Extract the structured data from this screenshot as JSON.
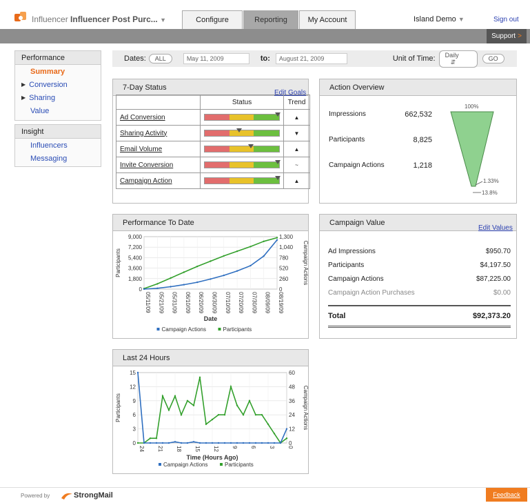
{
  "header": {
    "app_name": "Influencer",
    "campaign_title": "Influencer Post Purc...",
    "tabs": [
      {
        "label": "Configure"
      },
      {
        "label": "Reporting"
      },
      {
        "label": "My Account"
      }
    ],
    "account": "Island Demo",
    "signout": "Sign out",
    "support": "Support"
  },
  "sidebar": {
    "performance_title": "Performance",
    "performance_items": [
      {
        "label": "Summary",
        "active": true
      },
      {
        "label": "Conversion",
        "expandable": true
      },
      {
        "label": "Sharing",
        "expandable": true
      },
      {
        "label": "Value"
      }
    ],
    "insight_title": "Insight",
    "insight_items": [
      {
        "label": "Influencers"
      },
      {
        "label": "Messaging"
      }
    ]
  },
  "datebar": {
    "dates_label": "Dates:",
    "all_button": "ALL",
    "from_date": "May 11, 2009",
    "to_label": "to:",
    "to_date": "August 21, 2009",
    "unit_label": "Unit of Time:",
    "unit_value": "Daily",
    "go_button": "GO"
  },
  "status": {
    "title": "7-Day Status",
    "edit_link": "Edit Goals",
    "col_status": "Status",
    "col_trend": "Trend",
    "rows": [
      {
        "label": "Ad Conversion",
        "level": 1.0,
        "trend": "▲"
      },
      {
        "label": "Sharing Activity",
        "level": 0.48,
        "trend": "▼"
      },
      {
        "label": "Email Volume",
        "level": 0.64,
        "trend": "▲"
      },
      {
        "label": "Invite Conversion",
        "level": 1.0,
        "trend": "~"
      },
      {
        "label": "Campaign Action",
        "level": 1.0,
        "trend": "▲"
      }
    ]
  },
  "action_overview": {
    "title": "Action Overview",
    "rows": [
      {
        "label": "Impressions",
        "value": "662,532"
      },
      {
        "label": "Participants",
        "value": "8,825"
      },
      {
        "label": "Campaign Actions",
        "value": "1,218"
      }
    ],
    "funnel_labels": [
      "100%",
      "1.33%",
      "13.8%"
    ]
  },
  "perf_chart": {
    "title": "Performance To Date",
    "y_left_ticks": [
      "9,000",
      "7,200",
      "5,400",
      "3,600",
      "1,800",
      "0"
    ],
    "y_right_ticks": [
      "1,300",
      "1,040",
      "780",
      "520",
      "260",
      "0"
    ],
    "y_left_label": "Participants",
    "y_right_label": "Campaign Actions",
    "x_ticks": [
      "05/11/09",
      "05/21/09",
      "05/31/09",
      "06/10/09",
      "06/20/09",
      "06/30/09",
      "07/10/09",
      "07/20/09",
      "07/30/09",
      "08/09/09",
      "08/19/09"
    ],
    "x_label": "Date",
    "legend_campaign": "Campaign Actions",
    "legend_participants": "Participants"
  },
  "campaign_value": {
    "title": "Campaign Value",
    "edit_link": "Edit Values",
    "rows": [
      {
        "label": "Ad Impressions",
        "value": "$950.70"
      },
      {
        "label": "Participants",
        "value": "$4,197.50"
      },
      {
        "label": "Campaign Actions",
        "value": "$87,225.00"
      },
      {
        "label": "Campaign Action Purchases",
        "value": "$0.00"
      }
    ],
    "total_label": "Total",
    "total_value": "$92,373.20"
  },
  "last24": {
    "title": "Last 24 Hours",
    "y_left_ticks": [
      "15",
      "12",
      "9",
      "6",
      "3",
      "0"
    ],
    "y_right_ticks": [
      "60",
      "48",
      "36",
      "24",
      "12",
      "0"
    ],
    "y_left_label": "Participants",
    "y_right_label": "Campaign Actions",
    "x_ticks": [
      "24",
      "21",
      "18",
      "15",
      "12",
      "9",
      "6",
      "3",
      "0"
    ],
    "x_label": "Time (Hours Ago)",
    "legend_campaign": "Campaign Actions",
    "legend_participants": "Participants"
  },
  "footer": {
    "powered_by": "Powered by",
    "brand": "StrongMail",
    "feedback": "Feedback"
  },
  "colors": {
    "accent": "#e86a1a",
    "link": "#2a3fb0",
    "green": "#33a02c",
    "blue": "#2f6fc0",
    "funnel": "#8fd18f"
  },
  "chart_data": [
    {
      "type": "line",
      "title": "Performance To Date",
      "xlabel": "Date",
      "x": [
        "05/11/09",
        "05/21/09",
        "05/31/09",
        "06/10/09",
        "06/20/09",
        "06/30/09",
        "07/10/09",
        "07/20/09",
        "07/30/09",
        "08/09/09",
        "08/19/09"
      ],
      "series": [
        {
          "name": "Participants",
          "axis": "left",
          "values": [
            100,
            900,
            1900,
            2900,
            3900,
            4800,
            5700,
            6500,
            7300,
            8200,
            8825
          ]
        },
        {
          "name": "Campaign Actions",
          "axis": "right",
          "values": [
            0,
            20,
            60,
            110,
            170,
            250,
            340,
            450,
            580,
            820,
            1218
          ]
        }
      ],
      "ylim_left": [
        0,
        9000
      ],
      "ylim_right": [
        0,
        1300
      ],
      "grid": true,
      "legend": "bottom"
    },
    {
      "type": "line",
      "title": "Last 24 Hours",
      "xlabel": "Time (Hours Ago)",
      "x": [
        24,
        23,
        22,
        21,
        20,
        19,
        18,
        17,
        16,
        15,
        14,
        13,
        12,
        11,
        10,
        9,
        8,
        7,
        6,
        5,
        4,
        3,
        2,
        1,
        0
      ],
      "series": [
        {
          "name": "Participants",
          "axis": "left",
          "values": [
            0,
            0,
            1,
            1,
            10,
            7,
            10,
            6,
            9,
            8,
            14,
            4,
            5,
            6,
            6,
            12,
            8,
            6,
            9,
            6,
            6,
            4,
            2,
            0,
            1
          ]
        },
        {
          "name": "Campaign Actions",
          "axis": "right",
          "values": [
            60,
            0,
            0,
            0,
            0,
            0,
            1,
            0,
            0,
            1,
            0,
            0,
            0,
            0,
            0,
            0,
            0,
            0,
            0,
            0,
            0,
            0,
            0,
            0,
            12
          ]
        }
      ],
      "ylim_left": [
        0,
        15
      ],
      "ylim_right": [
        0,
        60
      ],
      "grid": true,
      "legend": "bottom"
    }
  ]
}
